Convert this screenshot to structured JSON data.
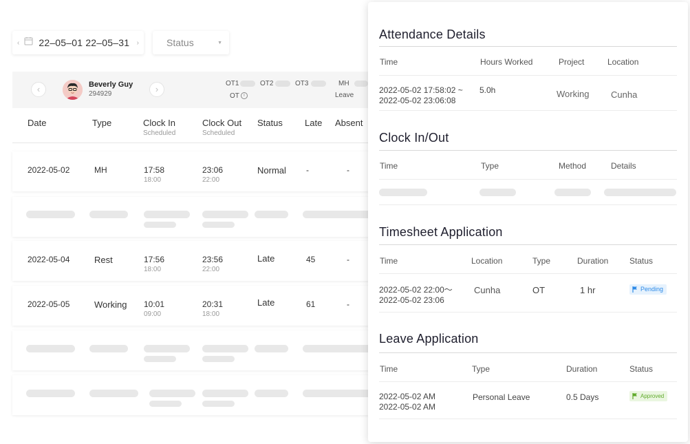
{
  "filters": {
    "date_range": "22–05–01 22–05–31",
    "status_placeholder": "Status"
  },
  "employee": {
    "name": "Beverly Guy",
    "id": "294929",
    "ot_labels": {
      "ot1": "OT1",
      "ot2": "OT2",
      "ot3": "OT3",
      "mh": "MH",
      "ot": "OT",
      "leave": "Leave"
    }
  },
  "table": {
    "headers": {
      "date": "Date",
      "type": "Type",
      "clock_in": "Clock In",
      "clock_in_sub": "Scheduled",
      "clock_out": "Clock Out",
      "clock_out_sub": "Scheduled",
      "status": "Status",
      "late": "Late",
      "absent": "Absent"
    },
    "rows": [
      {
        "date": "2022-05-02",
        "type": "MH",
        "clock_in": "17:58",
        "clock_in_sched": "18:00",
        "clock_out": "23:06",
        "clock_out_sched": "22:00",
        "status": "Normal",
        "late": "-",
        "absent": "-"
      },
      {
        "date": "2022-05-04",
        "type": "Rest",
        "clock_in": "17:56",
        "clock_in_sched": "18:00",
        "clock_out": "23:56",
        "clock_out_sched": "22:00",
        "status": "Late",
        "late": "45",
        "absent": "-"
      },
      {
        "date": "2022-05-05",
        "type": "Working",
        "clock_in": "10:01",
        "clock_in_sched": "09:00",
        "clock_out": "20:31",
        "clock_out_sched": "18:00",
        "status": "Late",
        "late": "61",
        "absent": "-"
      }
    ]
  },
  "panel": {
    "attendance": {
      "title": "Attendance Details",
      "headers": {
        "time": "Time",
        "hours": "Hours Worked",
        "project": "Project",
        "location": "Location"
      },
      "row": {
        "time_start": "2022-05-02 17:58:02 ~",
        "time_end": "2022-05-02  23:06:08",
        "hours": "5.0h",
        "project": "Working",
        "location": "Cunha"
      }
    },
    "clock": {
      "title": "Clock In/Out",
      "headers": {
        "time": "Time",
        "type": "Type",
        "method": "Method",
        "details": "Details"
      }
    },
    "timesheet": {
      "title": "Timesheet Application",
      "headers": {
        "time": "Time",
        "location": "Location",
        "type": "Type",
        "duration": "Duration",
        "status": "Status"
      },
      "row": {
        "time_start": "2022-05-02 22:00～",
        "time_end": "2022-05-02 23:06",
        "location": "Cunha",
        "type": "OT",
        "duration": "1 hr",
        "status": "Pending"
      }
    },
    "leave": {
      "title": "Leave Application",
      "headers": {
        "time": "Time",
        "type": "Type",
        "duration": "Duration",
        "status": "Status"
      },
      "row": {
        "time_start": "2022-05-02  AM",
        "time_end": "2022-05-02  AM",
        "type": "Personal Leave",
        "duration": "0.5 Days",
        "status": "Approved"
      }
    }
  },
  "colors": {
    "pending": "#2d8ae8",
    "approved": "#5faa2a",
    "skeleton": "#e8e8e8"
  }
}
